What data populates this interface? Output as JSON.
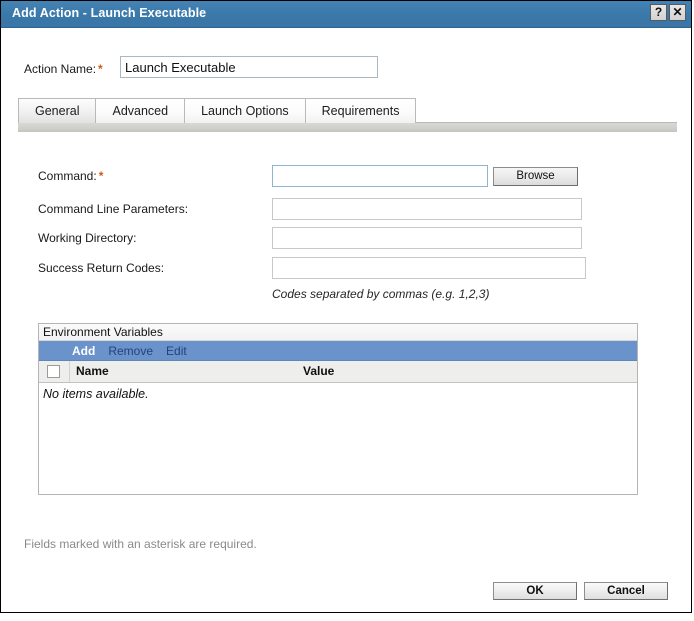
{
  "window": {
    "title": "Add Action - Launch Executable",
    "help_button": "?",
    "close_button": "✕",
    "titlebar_color": "#3b79ab"
  },
  "action_name": {
    "label": "Action Name:",
    "required_marker": "*",
    "value": "Launch Executable",
    "placeholder": ""
  },
  "tabs": [
    {
      "label": "General",
      "selected": true
    },
    {
      "label": "Advanced",
      "selected": false
    },
    {
      "label": "Launch Options",
      "selected": false
    },
    {
      "label": "Requirements",
      "selected": false
    }
  ],
  "form": {
    "command": {
      "label": "Command:",
      "required_marker": "*",
      "value": "",
      "placeholder": ""
    },
    "command_line_parameters": {
      "label": "Command Line Parameters:",
      "value": "",
      "placeholder": ""
    },
    "working_directory": {
      "label": "Working Directory:",
      "value": "",
      "placeholder": ""
    },
    "success_return_codes": {
      "label": "Success Return Codes:",
      "value": "",
      "placeholder": ""
    },
    "browse_button": "Browse",
    "hint": "Codes separated by commas (e.g. 1,2,3)"
  },
  "environment_variables": {
    "title": "Environment Variables",
    "toolbar": [
      {
        "label": "Add",
        "active": true
      },
      {
        "label": "Remove",
        "active": false
      },
      {
        "label": "Edit",
        "active": false
      }
    ],
    "toolbar_color": "#6a93cb",
    "columns": [
      "Name",
      "Value"
    ],
    "rows": [],
    "empty_message": "No items available."
  },
  "footer": {
    "required_note": "Fields marked with an asterisk are required.",
    "ok_button": "OK",
    "cancel_button": "Cancel"
  }
}
